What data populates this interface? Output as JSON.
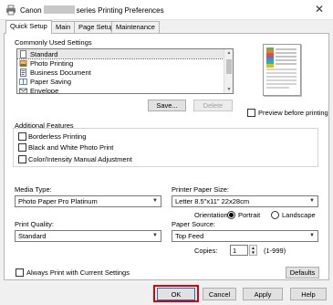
{
  "window": {
    "title_prefix": "Canon",
    "title_suffix": "series Printing Preferences",
    "close_glyph": "✕"
  },
  "tabs": [
    {
      "label": "Quick Setup",
      "active": true
    },
    {
      "label": "Main",
      "active": false
    },
    {
      "label": "Page Setup",
      "active": false
    },
    {
      "label": "Maintenance",
      "active": false
    }
  ],
  "commonly_used": {
    "heading": "Commonly Used Settings",
    "items": [
      {
        "label": "Standard",
        "icon": "document-icon",
        "selected": true
      },
      {
        "label": "Photo Printing",
        "icon": "photo-icon",
        "selected": false
      },
      {
        "label": "Business Document",
        "icon": "business-document-icon",
        "selected": false
      },
      {
        "label": "Paper Saving",
        "icon": "paper-saving-icon",
        "selected": false
      },
      {
        "label": "Envelope",
        "icon": "envelope-icon",
        "selected": false
      }
    ],
    "save_button": "Save...",
    "delete_button": "Delete"
  },
  "preview": {
    "checkbox_label": "Preview before printing",
    "checked": false
  },
  "additional_features": {
    "heading": "Additional Features",
    "options": [
      {
        "label": "Borderless Printing",
        "checked": false
      },
      {
        "label": "Black and White Photo Print",
        "checked": false
      },
      {
        "label": "Color/Intensity Manual Adjustment",
        "checked": false
      }
    ]
  },
  "media_type": {
    "label": "Media Type:",
    "value": "Photo Paper Pro Platinum"
  },
  "printer_paper_size": {
    "label": "Printer Paper Size:",
    "value": "Letter 8.5\"x11\" 22x28cm"
  },
  "orientation": {
    "label": "Orientation:",
    "portrait_label": "Portrait",
    "landscape_label": "Landscape",
    "selected": "Portrait"
  },
  "print_quality": {
    "label": "Print Quality:",
    "value": "Standard"
  },
  "paper_source": {
    "label": "Paper Source:",
    "value": "Top Feed"
  },
  "copies": {
    "label": "Copies:",
    "value": "1",
    "range": "(1-999)"
  },
  "always_print": {
    "label": "Always Print with Current Settings",
    "checked": false
  },
  "defaults_button": "Defaults",
  "footer": {
    "ok": "OK",
    "cancel": "Cancel",
    "apply": "Apply",
    "help": "Help"
  },
  "colors": {
    "highlight_border": "#e00000",
    "ok_border": "#0078d7"
  }
}
